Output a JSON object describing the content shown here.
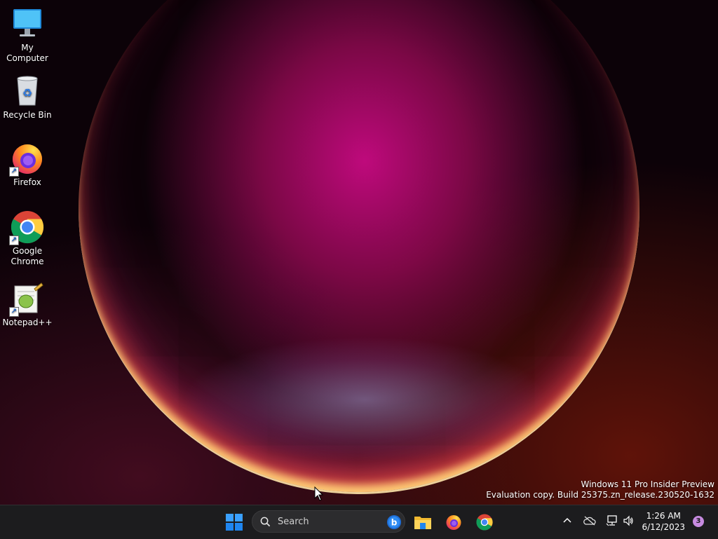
{
  "desktop_icons": [
    {
      "label": "My Computer",
      "icon": "monitor-icon"
    },
    {
      "label": "Recycle Bin",
      "icon": "recycle-bin-icon"
    },
    {
      "label": "Firefox",
      "icon": "firefox-icon"
    },
    {
      "label": "Google Chrome",
      "icon": "chrome-icon"
    },
    {
      "label": "Notepad++",
      "icon": "notepadpp-icon"
    }
  ],
  "watermark": {
    "line1": "Windows 11 Pro Insider Preview",
    "line2": "Evaluation copy. Build 25375.zn_release.230520-1632"
  },
  "taskbar": {
    "search_placeholder": "Search",
    "pinned": [
      "start-icon",
      "file-explorer-icon",
      "firefox-icon",
      "chrome-icon"
    ],
    "clock_time": "1:26 AM",
    "clock_date": "6/12/2023",
    "notification_count": "3"
  },
  "colors": {
    "taskbar_bg": "#1c1c1e",
    "windows_blue": "#0a84ff",
    "badge": "#c78be0"
  }
}
